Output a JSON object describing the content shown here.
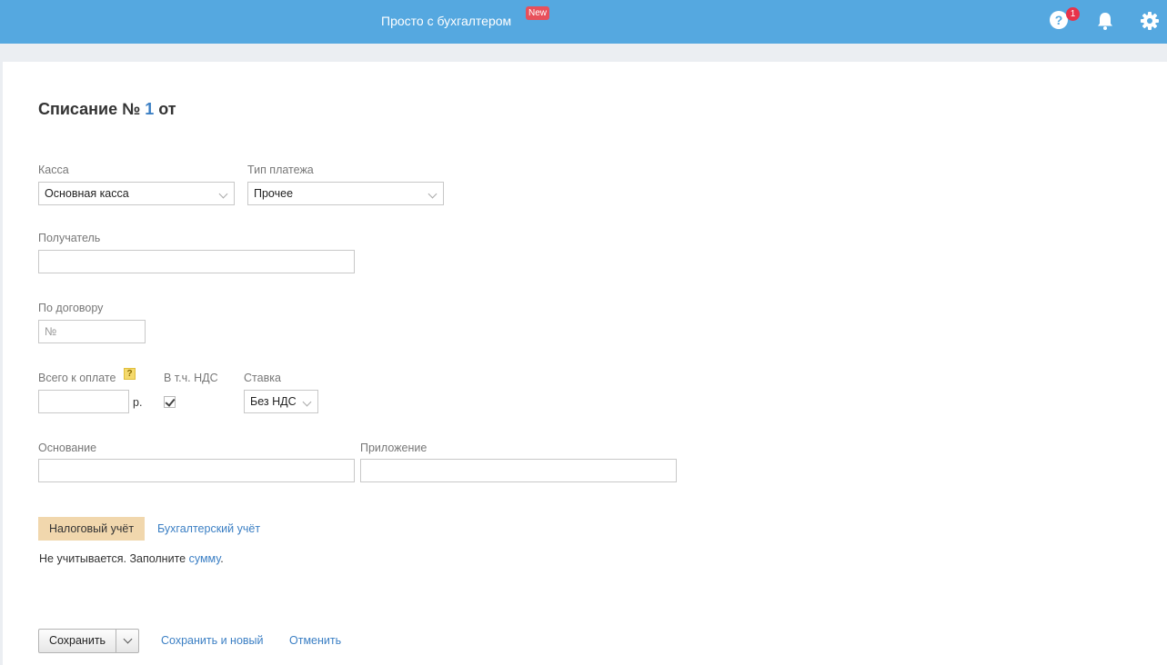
{
  "header": {
    "promo_text": "Просто с бухгалтером",
    "new_badge": "New",
    "help_count": "1",
    "help_glyph": "?",
    "icons": [
      "help-icon",
      "bell-icon",
      "gear-icon"
    ],
    "bar_color": "#55a8e0"
  },
  "form": {
    "title_prefix": "Списание №",
    "doc_number": "1",
    "title_suffix": "от",
    "kassa": {
      "label": "Касса",
      "value": "Основная касса"
    },
    "payment_type": {
      "label": "Тип платежа",
      "value": "Прочее"
    },
    "recipient": {
      "label": "Получатель",
      "value": ""
    },
    "contract": {
      "label": "По договору",
      "placeholder": "№"
    },
    "total": {
      "label": "Всего к оплате",
      "hint": "?",
      "value": "",
      "currency": "р."
    },
    "vat_included": {
      "label": "В т.ч. НДС",
      "checked": true
    },
    "rate": {
      "label": "Ставка",
      "value": "Без НДС"
    },
    "basis": {
      "label": "Основание",
      "value": ""
    },
    "attachment": {
      "label": "Приложение",
      "value": ""
    }
  },
  "accounting": {
    "tab_tax": "Налоговый учёт",
    "tab_accounting": "Бухгалтерский учёт",
    "note_text": "Не учитывается. Заполните ",
    "note_link": "сумму",
    "note_end": ".",
    "active_tab_color": "#f1d7ad"
  },
  "actions": {
    "save": "Сохранить",
    "save_and_new": "Сохранить и новый",
    "cancel": "Отменить"
  }
}
